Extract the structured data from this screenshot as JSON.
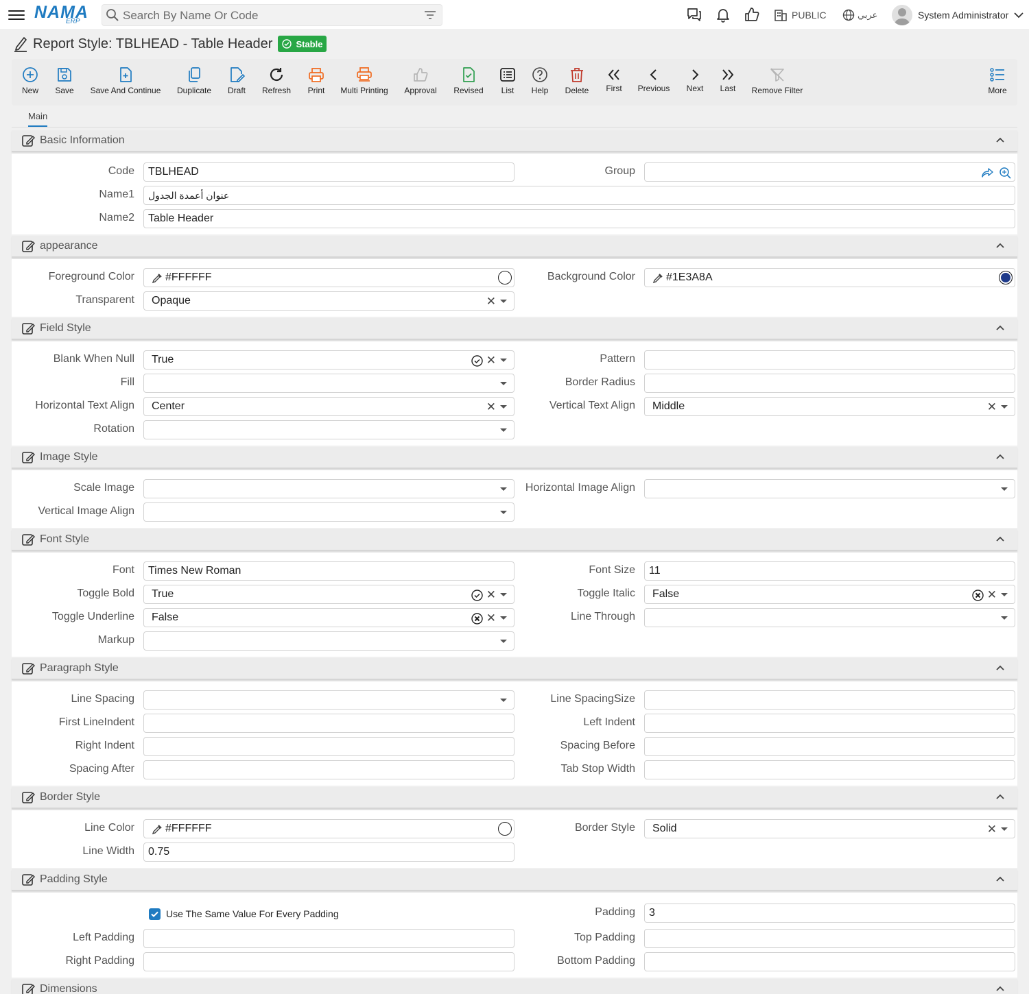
{
  "topbar": {
    "logo_text": "NAMA",
    "logo_sub": "ERP",
    "search_placeholder": "Search By Name Or Code",
    "public_label": "PUBLIC",
    "language_label": "عربي",
    "user_name": "System Administrator"
  },
  "page": {
    "title": "Report Style: TBLHEAD - Table Header",
    "status": "Stable"
  },
  "toolbar": {
    "new": "New",
    "save": "Save",
    "save_continue": "Save And Continue",
    "duplicate": "Duplicate",
    "draft": "Draft",
    "refresh": "Refresh",
    "print": "Print",
    "multi_printing": "Multi Printing",
    "approval": "Approval",
    "revised": "Revised",
    "list": "List",
    "help": "Help",
    "delete": "Delete",
    "first": "First",
    "previous": "Previous",
    "next": "Next",
    "last": "Last",
    "remove_filter": "Remove Filter",
    "more": "More"
  },
  "tabs": {
    "main": "Main"
  },
  "sections": {
    "basic": "Basic Information",
    "appearance": "appearance",
    "field_style": "Field Style",
    "image_style": "Image Style",
    "font_style": "Font Style",
    "paragraph_style": "Paragraph Style",
    "border_style": "Border Style",
    "padding_style": "Padding Style",
    "dimensions": "Dimensions"
  },
  "basic": {
    "code_label": "Code",
    "code": "TBLHEAD",
    "group_label": "Group",
    "group": "",
    "name1_label": "Name1",
    "name1": "عنوان أعمدة الجدول",
    "name2_label": "Name2",
    "name2": "Table Header"
  },
  "appearance": {
    "fg_label": "Foreground Color",
    "fg": "#FFFFFF",
    "fg_swatch": "#FFFFFF",
    "bg_label": "Background Color",
    "bg": "#1E3A8A",
    "bg_swatch": "#1E3A8A",
    "transparent_label": "Transparent",
    "transparent": "Opaque"
  },
  "field_style": {
    "blank_label": "Blank When Null",
    "blank": "True",
    "pattern_label": "Pattern",
    "pattern": "",
    "fill_label": "Fill",
    "fill": "",
    "radius_label": "Border Radius",
    "radius": "",
    "halign_label": "Horizontal Text Align",
    "halign": "Center",
    "valign_label": "Vertical Text Align",
    "valign": "Middle",
    "rotation_label": "Rotation",
    "rotation": ""
  },
  "image_style": {
    "scale_label": "Scale Image",
    "scale": "",
    "h_label": "Horizontal Image Align",
    "h": "",
    "v_label": "Vertical Image Align",
    "v": ""
  },
  "font_style": {
    "font_label": "Font",
    "font": "Times New Roman",
    "size_label": "Font Size",
    "size": "11",
    "bold_label": "Toggle Bold",
    "bold": "True",
    "italic_label": "Toggle Italic",
    "italic": "False",
    "underline_label": "Toggle Underline",
    "underline": "False",
    "through_label": "Line Through",
    "through": "",
    "markup_label": "Markup",
    "markup": ""
  },
  "paragraph_style": {
    "spacing_label": "Line Spacing",
    "spacing": "",
    "spacing_size_label": "Line SpacingSize",
    "spacing_size": "",
    "first_indent_label": "First LineIndent",
    "first_indent": "",
    "left_indent_label": "Left Indent",
    "left_indent": "",
    "right_indent_label": "Right Indent",
    "right_indent": "",
    "spacing_before_label": "Spacing Before",
    "spacing_before": "",
    "spacing_after_label": "Spacing After",
    "spacing_after": "",
    "tab_stop_label": "Tab Stop Width",
    "tab_stop": ""
  },
  "border_style": {
    "line_color_label": "Line Color",
    "line_color": "#FFFFFF",
    "line_swatch": "#FFFFFF",
    "style_label": "Border Style",
    "style": "Solid",
    "width_label": "Line Width",
    "width": "0.75"
  },
  "padding_style": {
    "same_label": "Use The Same Value For Every Padding",
    "same_checked": true,
    "padding_label": "Padding",
    "padding": "3",
    "left_label": "Left Padding",
    "left": "",
    "top_label": "Top Padding",
    "top": "",
    "right_label": "Right Padding",
    "right": "",
    "bottom_label": "Bottom Padding",
    "bottom": ""
  },
  "colors": {
    "accent": "#1F7BC1",
    "stable": "#28A745",
    "print_orange": "#F06A1F",
    "delete_red": "#C0392B",
    "revised_green": "#2E9E4F"
  }
}
